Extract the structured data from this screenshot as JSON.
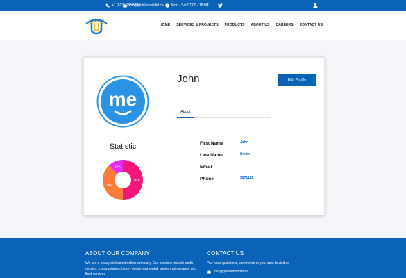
{
  "topbar": {
    "phone": "+1 (613) 838 5042",
    "email": "info@goldiemohrltd.ca",
    "hours": "Mon - Sat 07:00 - 18:00",
    "facebook_glyph": "f",
    "twitter_glyph": "t"
  },
  "nav": {
    "items": [
      "HOME",
      "SERVICES & PROJECTS",
      "PRODUCTS",
      "ABOUT US",
      "CAREERS",
      "CONTACT US"
    ]
  },
  "profile": {
    "name": "John",
    "edit_label": "Edit Profile",
    "tab_label": "About",
    "avatar_text": "me",
    "statistic_title": "Statistic",
    "fields": [
      {
        "label": "First Name",
        "value": "John"
      },
      {
        "label": "Last Name",
        "value": "Smith"
      },
      {
        "label": "Email",
        "value": ""
      },
      {
        "label": "Phone",
        "value": "5671111"
      }
    ]
  },
  "chart_data": {
    "type": "pie",
    "categories": [
      "",
      "",
      ""
    ],
    "values": [
      50,
      38,
      12
    ],
    "labels": [
      "50%",
      "38%",
      "12%"
    ],
    "colors": [
      "#f2187a",
      "#fb7c3b",
      "#e42cf0"
    ]
  },
  "footer": {
    "about_heading": "ABOUT OUR COMPANY",
    "about_line_1": "We are a heavy civil construction company. Our services include earth",
    "about_line_2": "moving, transportation, heavy equipment rental, winter maintenance and",
    "about_line_3": "fleet services.",
    "contact_heading": "CONTACT US",
    "contact_text": "You have questions, comments or you want to visit us",
    "contact_email": "info@goldiemohrltd.ca"
  },
  "colors": {
    "brand_blue": "#0a63b9",
    "avatar_blue": "#2b93e4"
  },
  "icons": [
    "phone-icon",
    "envelope-icon",
    "clock-icon",
    "facebook-icon",
    "twitter-icon",
    "user-icon"
  ]
}
